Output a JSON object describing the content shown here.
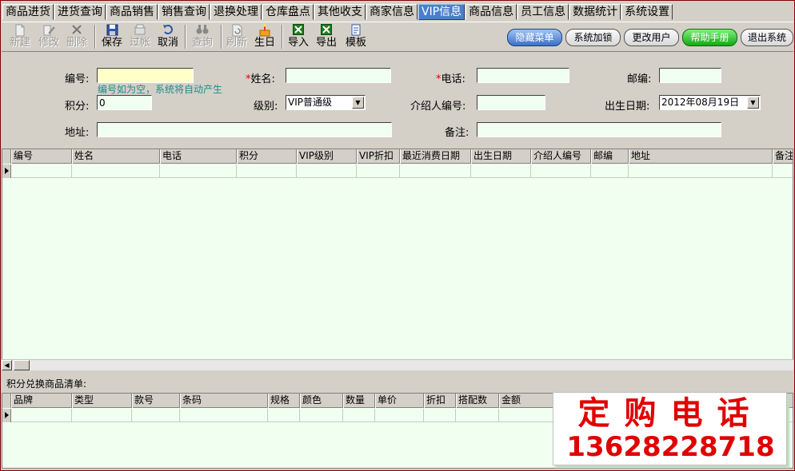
{
  "tabs": [
    {
      "label": "商品进货",
      "active": false
    },
    {
      "label": "进货查询",
      "active": false
    },
    {
      "label": "商品销售",
      "active": false
    },
    {
      "label": "销售查询",
      "active": false
    },
    {
      "label": "退换处理",
      "active": false
    },
    {
      "label": "仓库盘点",
      "active": false
    },
    {
      "label": "其他收支",
      "active": false
    },
    {
      "label": "商家信息",
      "active": false
    },
    {
      "label": "VIP信息",
      "active": true
    },
    {
      "label": "商品信息",
      "active": false
    },
    {
      "label": "员工信息",
      "active": false
    },
    {
      "label": "数据统计",
      "active": false
    },
    {
      "label": "系统设置",
      "active": false
    }
  ],
  "toolbar": {
    "new": {
      "label": "新建",
      "icon": "new-document-icon",
      "enabled": false
    },
    "edit": {
      "label": "修改",
      "icon": "edit-document-icon",
      "enabled": false
    },
    "delete": {
      "label": "删除",
      "icon": "delete-x-icon",
      "enabled": false
    },
    "save": {
      "label": "保存",
      "icon": "save-disk-icon",
      "enabled": true
    },
    "post": {
      "label": "过帐",
      "icon": "post-icon",
      "enabled": false
    },
    "cancel": {
      "label": "取消",
      "icon": "undo-icon",
      "enabled": true
    },
    "query": {
      "label": "查询",
      "icon": "binoculars-icon",
      "enabled": false
    },
    "refresh": {
      "label": "刷新",
      "icon": "refresh-icon",
      "enabled": false
    },
    "birthday": {
      "label": "生日",
      "icon": "birthday-cake-icon",
      "enabled": true
    },
    "import": {
      "label": "导入",
      "icon": "excel-import-icon",
      "enabled": true
    },
    "export": {
      "label": "导出",
      "icon": "excel-export-icon",
      "enabled": true
    },
    "template": {
      "label": "模板",
      "icon": "template-icon",
      "enabled": true
    }
  },
  "actions": {
    "hide_menu": "隐藏菜单",
    "lock": "系统加锁",
    "change_user": "更改用户",
    "help": "帮助手册",
    "exit": "退出系统"
  },
  "form": {
    "id_label": "编号:",
    "id_value": "",
    "id_hint": "编号如为空，系统将自动产生",
    "name_label": "姓名:",
    "name_value": "",
    "phone_label": "电话:",
    "phone_value": "",
    "zip_label": "邮编:",
    "zip_value": "",
    "points_label": "积分:",
    "points_value": "0",
    "level_label": "级别:",
    "level_value": "VIP普通级",
    "referrer_label": "介绍人编号:",
    "referrer_value": "",
    "birth_label": "出生日期:",
    "birth_value": "2012年08月19日",
    "address_label": "地址:",
    "address_value": "",
    "remark_label": "备注:",
    "remark_value": ""
  },
  "vip_grid": {
    "columns": [
      "编号",
      "姓名",
      "电话",
      "积分",
      "VIP级别",
      "VIP折扣",
      "最近消费日期",
      "出生日期",
      "介绍人编号",
      "邮编",
      "地址",
      "备注"
    ]
  },
  "exchange": {
    "label": "积分兑换商品清单:",
    "columns": [
      "品牌",
      "类型",
      "款号",
      "条码",
      "规格",
      "颜色",
      "数量",
      "单价",
      "折扣",
      "搭配数",
      "金额"
    ]
  },
  "promo": {
    "line1": "定购电话",
    "line2": "13628228718"
  },
  "colors": {
    "accent": "#4a7fc9",
    "grid_bg": "#f0fff0",
    "required": "#e00000",
    "hint": "#1f8c8c",
    "help_button": "#14a814"
  }
}
